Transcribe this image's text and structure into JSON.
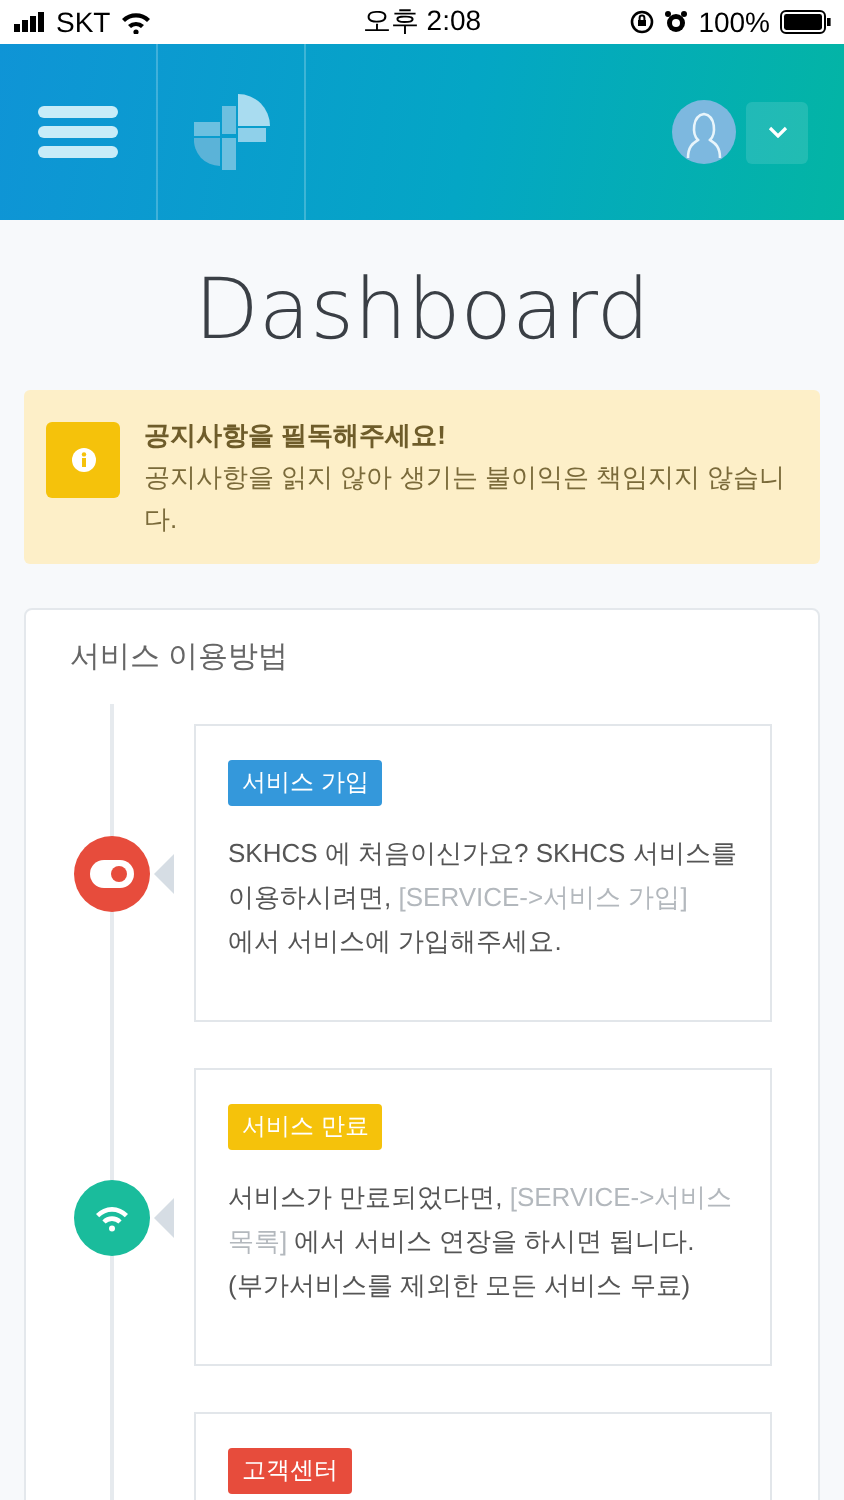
{
  "status_bar": {
    "carrier": "SKT",
    "time": "오후 2:08",
    "battery": "100%"
  },
  "page": {
    "title": "Dashboard"
  },
  "notice": {
    "title": "공지사항을 필독해주세요!",
    "message": "공지사항을 읽지 않아 생기는 불이익은 책임지지 않습니다."
  },
  "guide": {
    "title": "서비스 이용방법",
    "steps": [
      {
        "kind": "toggle",
        "color": "#e74c3c",
        "tag": {
          "label": "서비스 가입",
          "color": "#3498db"
        },
        "body": [
          {
            "text": "SKHCS 에 처음이신가요? SKHCS 서비스를 이용하시려면, ",
            "muted": false
          },
          {
            "text": "[SERVICE->서비스 가입]",
            "muted": true
          },
          {
            "text": " 에서 서비스에 가입해주세요.",
            "muted": false
          }
        ]
      },
      {
        "kind": "wifi",
        "color": "#1abc9c",
        "tag": {
          "label": "서비스 만료",
          "color": "#f5c20b"
        },
        "body": [
          {
            "text": "서비스가 만료되었다면, ",
            "muted": false
          },
          {
            "text": "[SERVICE->서비스 목록]",
            "muted": true
          },
          {
            "text": " 에서 서비스 연장을 하시면 됩니다. (부가서비스를 제외한 모든 서비스 무료)",
            "muted": false
          }
        ]
      },
      {
        "tag": {
          "label": "고객센터",
          "color": "#e74c3c"
        }
      }
    ]
  }
}
